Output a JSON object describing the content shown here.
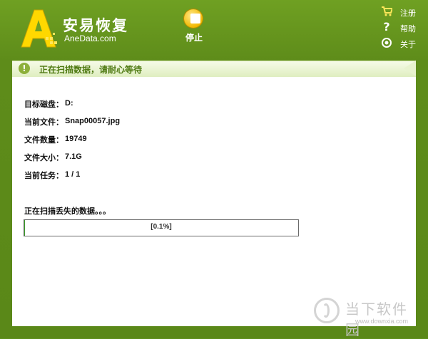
{
  "header": {
    "brand_cn": "安易恢复",
    "brand_en": "AneData.com",
    "stop_label": "停止",
    "menu": [
      {
        "icon": "cart-icon",
        "label": "注册"
      },
      {
        "icon": "help-icon",
        "label": "帮助"
      },
      {
        "icon": "about-icon",
        "label": "关于"
      }
    ]
  },
  "status": {
    "text": "正在扫描数据，请耐心等待"
  },
  "details": [
    {
      "label": "目标磁盘：",
      "value": "D:"
    },
    {
      "label": "当前文件：",
      "value": "Snap00057.jpg"
    },
    {
      "label": "文件数量：",
      "value": "19749"
    },
    {
      "label": "文件大小：",
      "value": "7.1G"
    },
    {
      "label": "当前任务：",
      "value": "1 / 1"
    }
  ],
  "scan": {
    "message": "正在扫描丢失的数据。。。",
    "progress_text": "[0.1%]",
    "progress_percent": 0.1
  },
  "watermark": {
    "name": "当下软件园",
    "url": "www.downxia.com"
  },
  "colors": {
    "header_green": "#5e8c1a",
    "accent_yellow": "#ffe75a",
    "progress_green": "#3a9a2a",
    "status_text": "#4f7a12"
  }
}
